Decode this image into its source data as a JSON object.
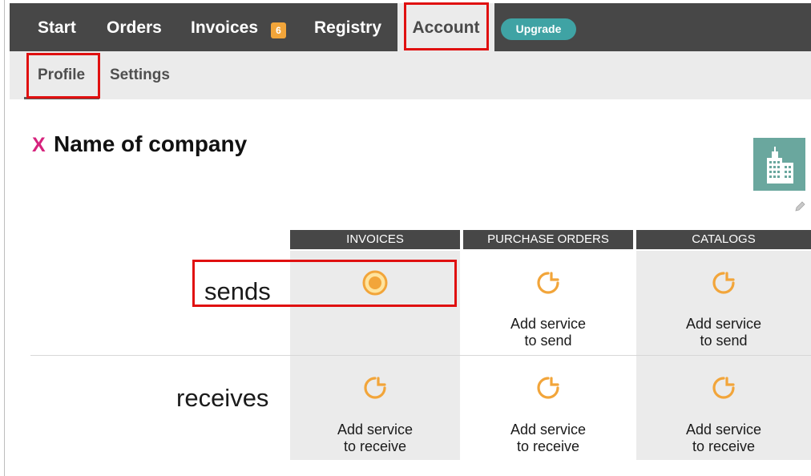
{
  "nav": {
    "items": [
      {
        "label": "Start"
      },
      {
        "label": "Orders"
      },
      {
        "label": "Invoices",
        "badge": "6"
      },
      {
        "label": "Registry"
      },
      {
        "label": "Account"
      }
    ],
    "upgrade_label": "Upgrade"
  },
  "subnav": {
    "items": [
      {
        "label": "Profile"
      },
      {
        "label": "Settings"
      }
    ]
  },
  "company": {
    "close_mark": "X",
    "name": "Name of company"
  },
  "table": {
    "columns": [
      "INVOICES",
      "PURCHASE ORDERS",
      "CATALOGS"
    ],
    "rows": [
      {
        "label": "sends",
        "cells": [
          {
            "state": "active",
            "text_line1": "",
            "text_line2": ""
          },
          {
            "state": "add",
            "text_line1": "Add service",
            "text_line2": "to send"
          },
          {
            "state": "add",
            "text_line1": "Add service",
            "text_line2": "to send"
          }
        ]
      },
      {
        "label": "receives",
        "cells": [
          {
            "state": "add",
            "text_line1": "Add service",
            "text_line2": "to receive"
          },
          {
            "state": "add",
            "text_line1": "Add service",
            "text_line2": "to receive"
          },
          {
            "state": "add",
            "text_line1": "Add service",
            "text_line2": "to receive"
          }
        ]
      }
    ]
  },
  "colors": {
    "nav_bg": "#474747",
    "subnav_bg": "#ebebeb",
    "accent_orange": "#f2a53a",
    "upgrade_teal": "#3fa3a4",
    "close_pink": "#d6237d",
    "highlight_red": "#e01010"
  },
  "icons": {
    "active": "radio-active-icon",
    "add": "add-service-icon",
    "logo": "building-icon",
    "edit": "pencil-icon"
  }
}
